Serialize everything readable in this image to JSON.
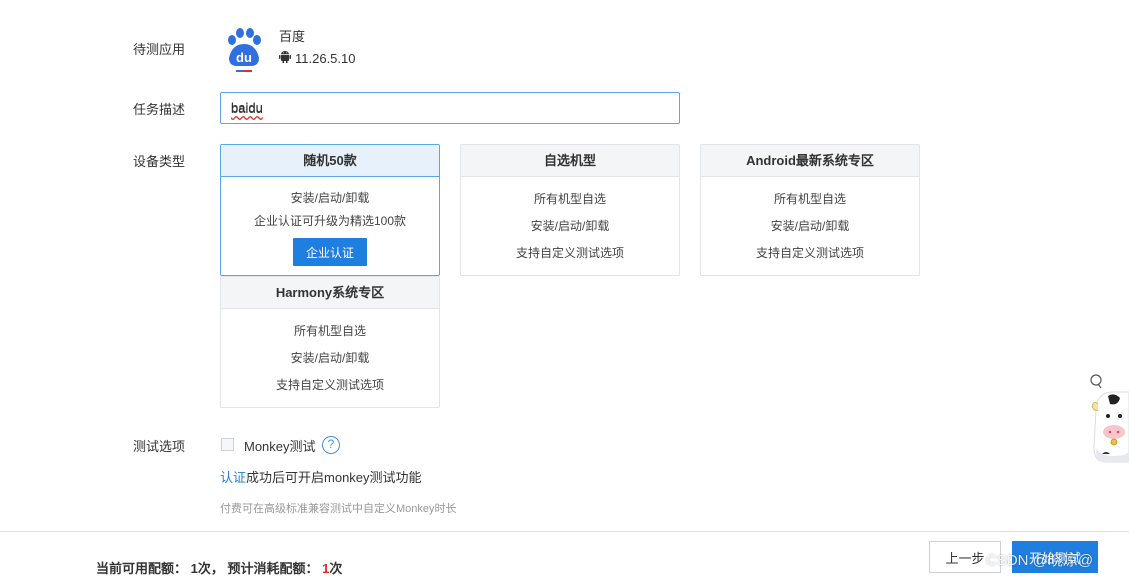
{
  "labels": {
    "app": "待测应用",
    "task": "任务描述",
    "device_type": "设备类型",
    "test_options": "测试选项"
  },
  "app": {
    "name": "百度",
    "version": "11.26.5.10",
    "platform_icon": "android-icon",
    "logo_text": "du"
  },
  "task": {
    "value": "baidu"
  },
  "device_cards": [
    {
      "title": "随机50款",
      "lines": [
        "安装/启动/卸载",
        "企业认证可升级为精选100款"
      ],
      "button": "企业认证",
      "selected": true
    },
    {
      "title": "自选机型",
      "lines": [
        "所有机型自选",
        "安装/启动/卸载",
        "支持自定义测试选项"
      ]
    },
    {
      "title": "Android最新系统专区",
      "lines": [
        "所有机型自选",
        "安装/启动/卸载",
        "支持自定义测试选项"
      ]
    },
    {
      "title": "Harmony系统专区",
      "lines": [
        "所有机型自选",
        "安装/启动/卸载",
        "支持自定义测试选项"
      ]
    }
  ],
  "options": {
    "monkey_label": "Monkey测试",
    "monkey_checked": false,
    "help_glyph": "?",
    "cert_link": "认证",
    "cert_note_rest": "成功后可开启monkey测试功能",
    "paid_note": "付费可在高级标准兼容测试中自定义Monkey时长"
  },
  "footer": {
    "available_label": "当前可用配额：",
    "available_value": "1次",
    "separator": "，",
    "consume_label": "预计消耗配额：",
    "consume_value": "1",
    "consume_unit": "次",
    "prev_button": "上一步",
    "start_button": "开始测试",
    "watermark": "CSDN @晓凉@"
  },
  "colors": {
    "accent": "#1f7fe0",
    "selected_border": "#5aa7e6",
    "red": "#e0301e"
  }
}
